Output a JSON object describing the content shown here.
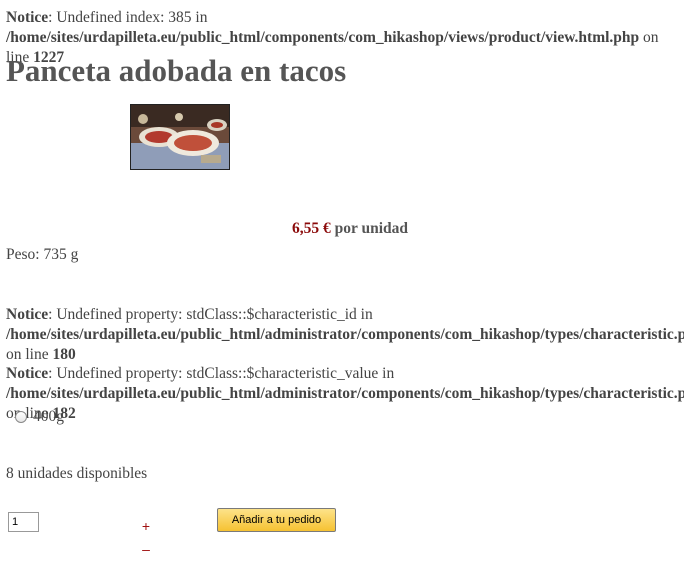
{
  "notices": [
    {
      "label": "Notice",
      "sep": ": ",
      "message": "Undefined index: 385 in ",
      "path": "/home/sites/urdapilleta.eu/public_html/components/com_hikashop/views/product/view.html.php",
      "online": " on line ",
      "line": "1227"
    },
    {
      "label": "Notice",
      "sep": ": ",
      "message": "Undefined property: stdClass::$characteristic_id in ",
      "path": "/home/sites/urdapilleta.eu/public_html/administrator/components/com_hikashop/types/characteristic.php",
      "online": " on line ",
      "line": "180"
    },
    {
      "label": "Notice",
      "sep": ": ",
      "message": "Undefined property: stdClass::$characteristic_value in ",
      "path": "/home/sites/urdapilleta.eu/public_html/administrator/components/com_hikashop/types/characteristic.php",
      "online": " on line ",
      "line": "182"
    }
  ],
  "product": {
    "title": "Panceta adobada en tacos",
    "price": "6,55 €",
    "price_unit": " por unidad",
    "weight": "Peso: 735 g",
    "variant": "400g",
    "stock": "8 unidades disponibles"
  },
  "cart": {
    "quantity": "1",
    "plus": "+",
    "minus": "–",
    "add_label": "Añadir a tu pedido"
  },
  "colors": {
    "price": "#8b0a0a",
    "text": "#444444",
    "button": "#f6c232"
  }
}
